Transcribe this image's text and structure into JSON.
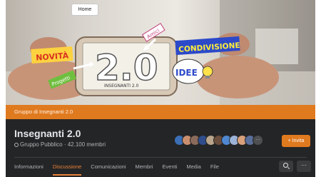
{
  "cover": {
    "home_label": "Home",
    "texts": {
      "novita": "NOVITÀ",
      "progetti": "Progetti",
      "amici": "Amici",
      "condivisione": "CONDIVISIONE",
      "idee": "IDEE",
      "big_20": "2.0",
      "screen_caption": "INSEGNANTI 2.0"
    }
  },
  "group_bar": {
    "label": "Gruppo di Insegnanti 2.0"
  },
  "header": {
    "title": "Insegnanti 2.0",
    "subtitle": "Gruppo Pubblico · 42.100 membri",
    "invite_label": "+ Invita",
    "more_avatars_label": "···"
  },
  "tabs": [
    {
      "label": "Informazioni"
    },
    {
      "label": "Discussione",
      "active": true
    },
    {
      "label": "Comunicazioni"
    },
    {
      "label": "Membri"
    },
    {
      "label": "Eventi"
    },
    {
      "label": "Media"
    },
    {
      "label": "File"
    }
  ],
  "actions": {
    "more_label": "···"
  },
  "colors": {
    "accent": "#e07a1f",
    "background": "#242526",
    "text": "#e4e6eb",
    "muted": "#b0b3b8"
  },
  "icons": [
    "globe-icon",
    "search-icon",
    "more-icon",
    "lightbulb-icon"
  ]
}
